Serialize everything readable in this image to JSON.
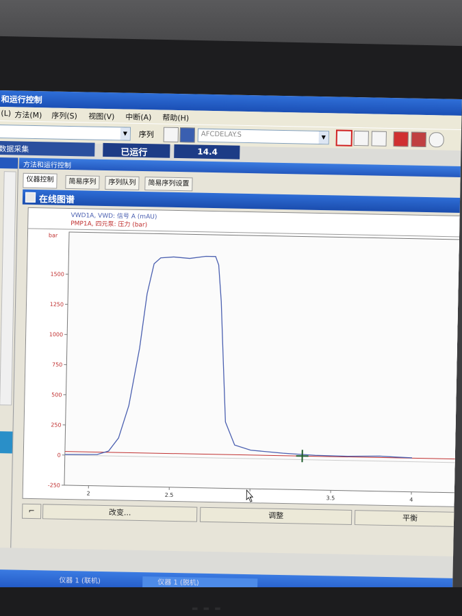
{
  "window": {
    "title": "和运行控制"
  },
  "menu": [
    "(L)",
    "方法(M)",
    "序列(S)",
    "视图(V)",
    "中断(A)",
    "帮助(H)"
  ],
  "toolbar": {
    "sequence_label": "序列",
    "method_value": "AFCDELAY.S"
  },
  "status": {
    "left_text": "数据采集",
    "run_state": "已运行",
    "run_time": "14.4"
  },
  "panel": {
    "title": "方法和运行控制"
  },
  "tabs": [
    "仪器控制",
    "简易序列",
    "序列队列",
    "简易序列设置"
  ],
  "online_plot": {
    "title": "在线图谱"
  },
  "legend": [
    {
      "label": "VWD1A, VWD: 信号 A (mAU)",
      "color": "#4a5fb0"
    },
    {
      "label": "PMP1A, 四元泵: 压力 (bar)",
      "color": "#c03030"
    }
  ],
  "footer_buttons": [
    "改变...",
    "调整",
    "平衡"
  ],
  "taskbar": {
    "items": [
      "仪器 1 (联机)",
      "仪器 1 (脱机)"
    ]
  },
  "chart_data": {
    "type": "line",
    "yunit": "bar",
    "xlim": [
      1.85,
      4.3
    ],
    "ylim": [
      -250,
      1850
    ],
    "xticks": [
      2,
      2.5,
      3,
      3.5,
      4
    ],
    "yticks": [
      -250,
      0,
      250,
      500,
      750,
      1000,
      1250,
      1500
    ],
    "series": [
      {
        "name": "VWD1A, VWD: 信号 A (mAU)",
        "color": "#4a5fb0",
        "x": [
          1.85,
          2.05,
          2.12,
          2.18,
          2.24,
          2.3,
          2.34,
          2.38,
          2.42,
          2.5,
          2.6,
          2.7,
          2.76,
          2.78,
          2.8,
          2.82,
          2.84,
          2.9,
          3.0,
          3.2,
          3.4,
          3.6,
          3.8,
          3.9,
          4.0
        ],
        "y": [
          5,
          10,
          40,
          150,
          420,
          900,
          1350,
          1600,
          1650,
          1660,
          1650,
          1670,
          1670,
          1600,
          1300,
          800,
          300,
          110,
          70,
          50,
          38,
          35,
          42,
          36,
          32
        ]
      },
      {
        "name": "PMP1A, 四元泵: 压力 (bar)",
        "color": "#c03030",
        "x": [
          1.85,
          4.3
        ],
        "y": [
          30,
          30
        ]
      }
    ]
  }
}
